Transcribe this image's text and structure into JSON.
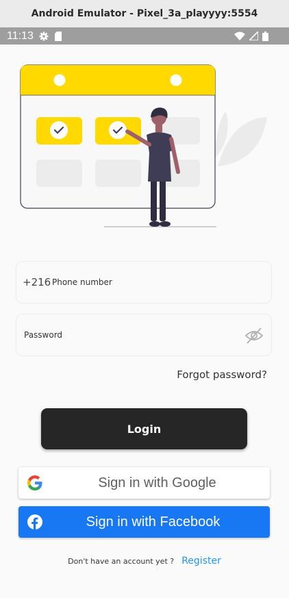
{
  "window": {
    "title": "Android Emulator - Pixel_3a_playyyy:5554"
  },
  "statusbar": {
    "time": "11:13",
    "icons": [
      "settings-icon",
      "sd-card-icon",
      "wifi-icon",
      "signal-icon",
      "battery-icon"
    ]
  },
  "form": {
    "phone": {
      "prefix": "+216",
      "placeholder": "Phone number"
    },
    "password": {
      "placeholder": "Password",
      "visibility_icon": "eye-off-icon"
    },
    "forgot_label": "Forgot password?",
    "login_label": "Login"
  },
  "social": {
    "google_label": "Sign in with Google",
    "facebook_label": "Sign in with Facebook"
  },
  "footer": {
    "question": "Don't have an account yet ?",
    "register_label": "Register"
  },
  "colors": {
    "accent_yellow": "#ffd900",
    "login_bg": "#262626",
    "facebook_blue": "#1877f2",
    "register_link": "#2196f3"
  }
}
